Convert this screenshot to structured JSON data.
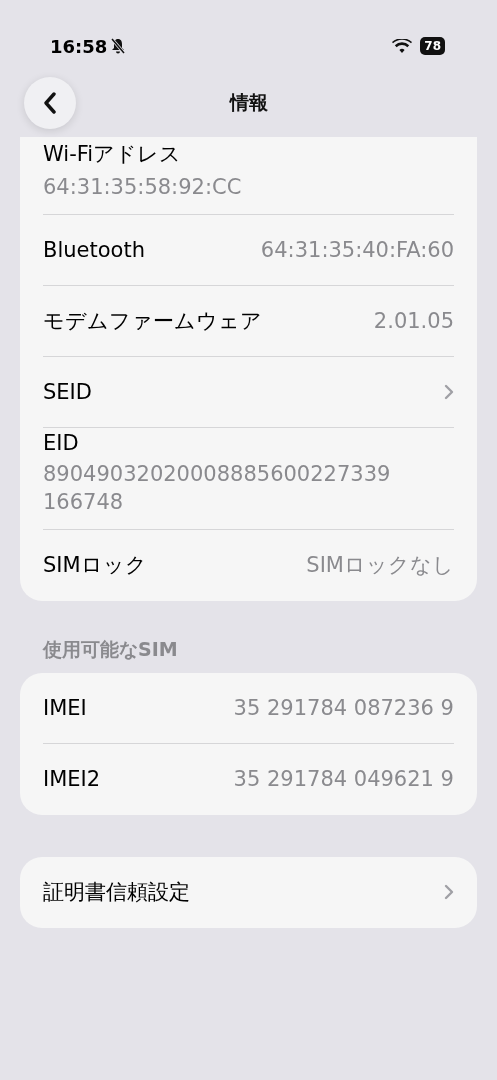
{
  "status_bar": {
    "time": "16:58",
    "battery": "78"
  },
  "nav": {
    "title": "情報"
  },
  "sections": [
    {
      "cut_top": true,
      "rows": [
        {
          "kind": "stacked",
          "label": "Wi-Fiアドレス",
          "value": "64:31:35:58:92:CC"
        },
        {
          "kind": "pair",
          "label": "Bluetooth",
          "value": "64:31:35:40:FA:60"
        },
        {
          "kind": "pair",
          "label": "モデムファームウェア",
          "value": "2.01.05"
        },
        {
          "kind": "link",
          "label": "SEID"
        },
        {
          "kind": "stacked",
          "label": "EID",
          "value": "89049032020008885600227339166748"
        },
        {
          "kind": "pair",
          "label": "SIMロック",
          "value": "SIMロックなし"
        }
      ]
    },
    {
      "header": "使用可能なSIM",
      "cut_top": false,
      "rows": [
        {
          "kind": "pair",
          "label": "IMEI",
          "value": "35 291784 087236 9"
        },
        {
          "kind": "pair",
          "label": "IMEI2",
          "value": "35 291784 049621 9"
        }
      ]
    },
    {
      "cut_top": false,
      "rows": [
        {
          "kind": "link",
          "label": "証明書信頼設定"
        }
      ]
    }
  ]
}
